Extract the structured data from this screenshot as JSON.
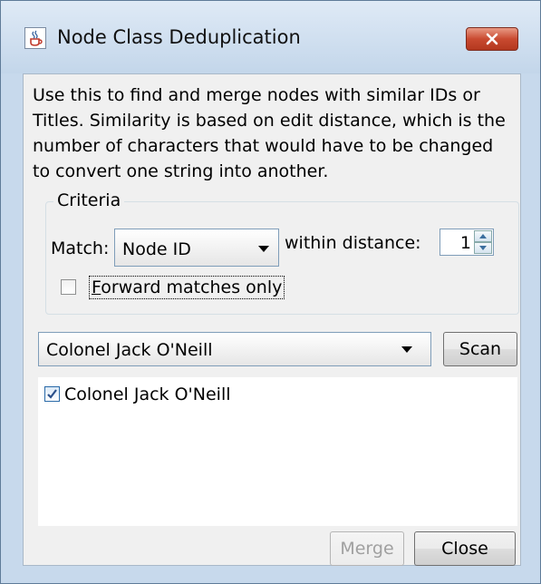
{
  "window": {
    "title": "Node Class Deduplication"
  },
  "icons": {
    "app": "java-cup-icon",
    "close": "close-x-icon",
    "dropdown": "chevron-down-icon",
    "check": "check-icon"
  },
  "description": "Use this to find and merge nodes with similar IDs or Titles. Similarity is based on edit distance, which is the number of characters that would have to be changed to convert one string into another.",
  "criteria": {
    "legend": "Criteria",
    "match_label": "Match:",
    "match_value": "Node ID",
    "within_label": "within distance:",
    "distance_value": "1",
    "forward_label_mnemonic": "F",
    "forward_label_rest": "orward matches only",
    "forward_checked": false
  },
  "scan": {
    "node_value": "Colonel Jack O'Neill",
    "scan_label": "Scan"
  },
  "results": [
    {
      "label": "Colonel Jack O'Neill",
      "checked": true
    }
  ],
  "footer": {
    "merge_label": "Merge",
    "merge_enabled": false,
    "close_label": "Close"
  },
  "colors": {
    "frame": "#c7d9ec",
    "close_button": "#c94a30",
    "check_accent": "#2a6aa8"
  }
}
